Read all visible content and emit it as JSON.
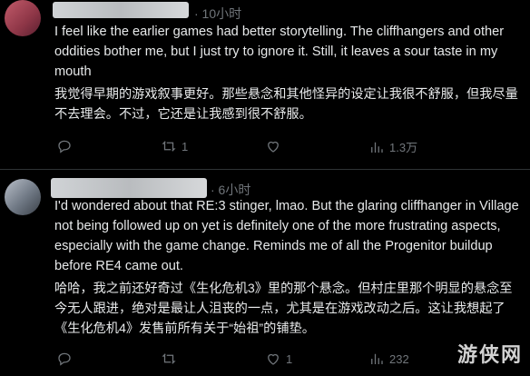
{
  "posts": [
    {
      "timestamp": "· 10小时",
      "text_en": "I feel like the earlier games had better storytelling. The cliffhangers and other oddities bother me, but I just try to ignore it. Still, it leaves a sour taste in my mouth",
      "text_zh": "我觉得早期的游戏叙事更好。那些悬念和其他怪异的设定让我很不舒服，但我尽量不去理会。不过，它还是让我感到很不舒服。",
      "actions": {
        "reply_count": "",
        "retweet_count": "1",
        "like_count": "",
        "view_count": "1.3万"
      }
    },
    {
      "timestamp": "· 6小时",
      "text_en": "I'd wondered about that RE:3 stinger, lmao. But the glaring cliffhanger in Village not being followed up on yet is definitely one of the more frustrating aspects, especially with the game change. Reminds me of all the Progenitor buildup before RE4 came out.",
      "text_zh": "哈哈，我之前还好奇过《生化危机3》里的那个悬念。但村庄里那个明显的悬念至今无人跟进，绝对是最让人沮丧的一点，尤其是在游戏改动之后。这让我想起了《生化危机4》发售前所有关于“始祖”的铺垫。",
      "actions": {
        "reply_count": "",
        "retweet_count": "",
        "like_count": "1",
        "view_count": "232"
      }
    }
  ],
  "watermark": "游侠网",
  "icons": {
    "reply": "reply-icon",
    "retweet": "retweet-icon",
    "like": "heart-icon",
    "views": "views-icon"
  }
}
